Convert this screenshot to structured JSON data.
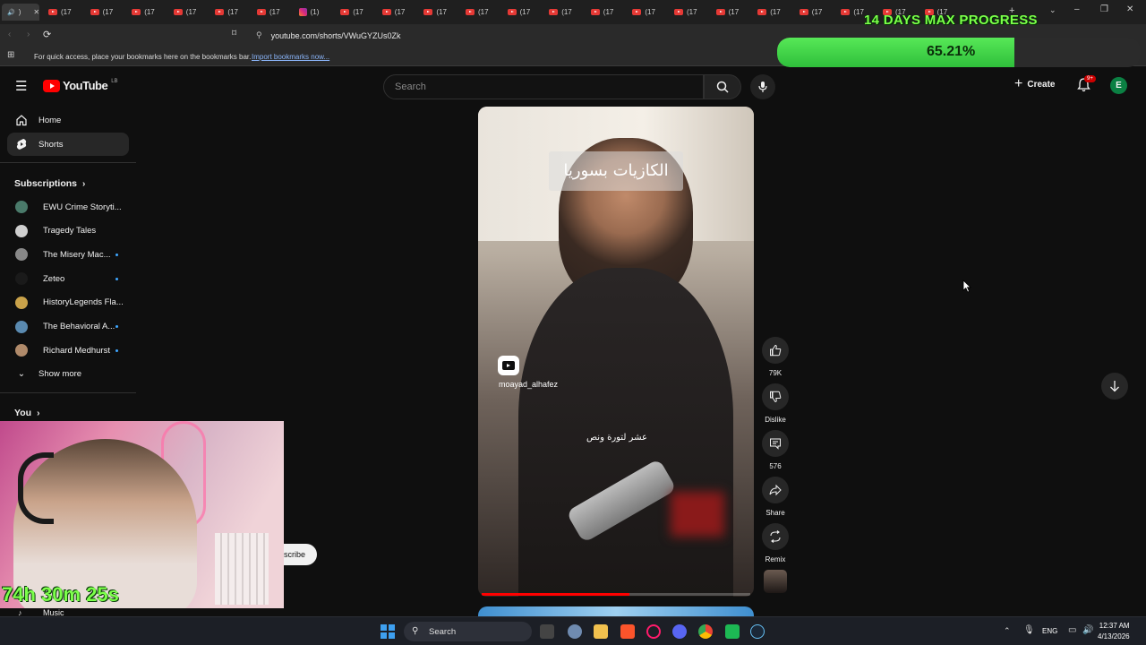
{
  "browser": {
    "tabs": [
      {
        "icon": "speaker-icon",
        "label": ")"
      },
      {
        "icon": "youtube-icon",
        "label": "(17"
      },
      {
        "icon": "youtube-icon",
        "label": "(17"
      },
      {
        "icon": "youtube-icon",
        "label": "(17"
      },
      {
        "icon": "youtube-icon",
        "label": "(17"
      },
      {
        "icon": "youtube-icon",
        "label": "(17"
      },
      {
        "icon": "youtube-icon",
        "label": "(17"
      },
      {
        "icon": "instagram-icon",
        "label": "(1)"
      },
      {
        "icon": "youtube-icon",
        "label": "(17"
      },
      {
        "icon": "youtube-icon",
        "label": "(17"
      },
      {
        "icon": "youtube-icon",
        "label": "(17"
      },
      {
        "icon": "youtube-icon",
        "label": "(17"
      },
      {
        "icon": "youtube-icon",
        "label": "(17"
      },
      {
        "icon": "youtube-icon",
        "label": "(17"
      },
      {
        "icon": "youtube-icon",
        "label": "(17"
      },
      {
        "icon": "youtube-icon",
        "label": "(17"
      },
      {
        "icon": "youtube-icon",
        "label": "(17"
      },
      {
        "icon": "youtube-icon",
        "label": "(17"
      },
      {
        "icon": "youtube-icon",
        "label": "(17"
      },
      {
        "icon": "youtube-icon",
        "label": "(17"
      },
      {
        "icon": "youtube-icon",
        "label": "(17"
      },
      {
        "icon": "youtube-icon",
        "label": "(17"
      },
      {
        "icon": "youtube-icon",
        "label": "(17"
      }
    ],
    "url": "youtube.com/shorts/VWuGYZUs0Zk",
    "bookmarks_hint": "For quick access, place your bookmarks here on the bookmarks bar.",
    "bookmarks_import": "Import bookmarks now..."
  },
  "overlay": {
    "progress_title": "14 DAYS MAX PROGRESS",
    "progress_percent_text": "65.21%",
    "progress_fraction": 0.6521,
    "timer": "74h 30m 25s",
    "subscribe_partial": "scribe"
  },
  "youtube": {
    "logo_text": "YouTube",
    "logo_region": "LB",
    "search_placeholder": "Search",
    "create_label": "Create",
    "notifications_badge": "9+",
    "avatar_letter": "E"
  },
  "sidebar": {
    "home": "Home",
    "shorts": "Shorts",
    "subscriptions_header": "Subscriptions",
    "subscriptions": [
      {
        "label": "EWU Crime Storyti...",
        "color": "#4a7a6a",
        "dot": false
      },
      {
        "label": "Tragedy Tales",
        "color": "#cfcfcf",
        "dot": false
      },
      {
        "label": "The Misery Mac...",
        "color": "#888888",
        "dot": true
      },
      {
        "label": "Zeteo",
        "color": "#1a1a1a",
        "dot": true
      },
      {
        "label": "HistoryLegends Fla...",
        "color": "#c9a24a",
        "dot": false
      },
      {
        "label": "The Behavioral A...",
        "color": "#5a8ab0",
        "dot": true
      },
      {
        "label": "Richard Medhurst",
        "color": "#b08a6a",
        "dot": true
      }
    ],
    "show_more": "Show more",
    "you_header": "You",
    "music": "Music"
  },
  "video": {
    "caption_top": "الكازيات بسوريا",
    "caption_bottom": "عشر لتورة ونص",
    "channel_watermark": "moayad_alhafez",
    "playback_fraction": 0.55
  },
  "actions": {
    "likes": "79K",
    "dislike": "Dislike",
    "comments": "576",
    "share": "Share",
    "remix": "Remix"
  },
  "taskbar": {
    "search": "Search",
    "lang": "ENG",
    "time": "12:37 AM",
    "date": "4/13/2026"
  }
}
